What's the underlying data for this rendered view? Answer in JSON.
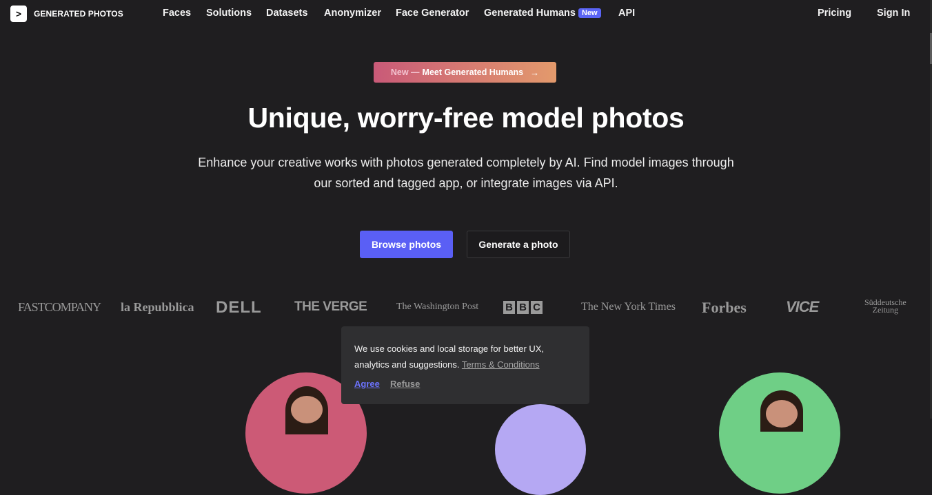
{
  "nav": {
    "logo_icon": ">",
    "brand": "GENERATED PHOTOS",
    "items": [
      "Faces",
      "Solutions",
      "Datasets",
      "Anonymizer",
      "Face Generator",
      "Generated Humans",
      "API"
    ],
    "badge": "New",
    "pricing": "Pricing",
    "sign_in": "Sign In"
  },
  "hero": {
    "pill_new": "New —",
    "pill_text": "Meet Generated Humans",
    "pill_arrow": "→",
    "title": "Unique, worry-free model photos",
    "subtitle": "Enhance your creative works with photos generated completely by AI. Find model images through our sorted and tagged app, or integrate images via API.",
    "primary_button": "Browse photos",
    "secondary_button": "Generate a photo"
  },
  "press": {
    "fastcompany": "FASTCOMPANY",
    "repubblica": "la Repubblica",
    "dell": "DELL",
    "verge": "THE VERGE",
    "wapo": "The Washington Post",
    "bbc": [
      "B",
      "B",
      "C"
    ],
    "nyt": "The New York Times",
    "forbes": "Forbes",
    "vice": "VICE",
    "sz_line1": "Süddeutsche",
    "sz_line2": "Zeitung"
  },
  "cookie": {
    "text": "We use cookies and local storage for better UX, analytics and suggestions.",
    "link": "Terms & Conditions",
    "agree": "Agree",
    "refuse": "Refuse"
  },
  "colors": {
    "background": "#1f1e20",
    "accent": "#5a5ff5",
    "pink": "#cc5a76",
    "lavender": "#b5a8f3",
    "green": "#6fcf86"
  }
}
